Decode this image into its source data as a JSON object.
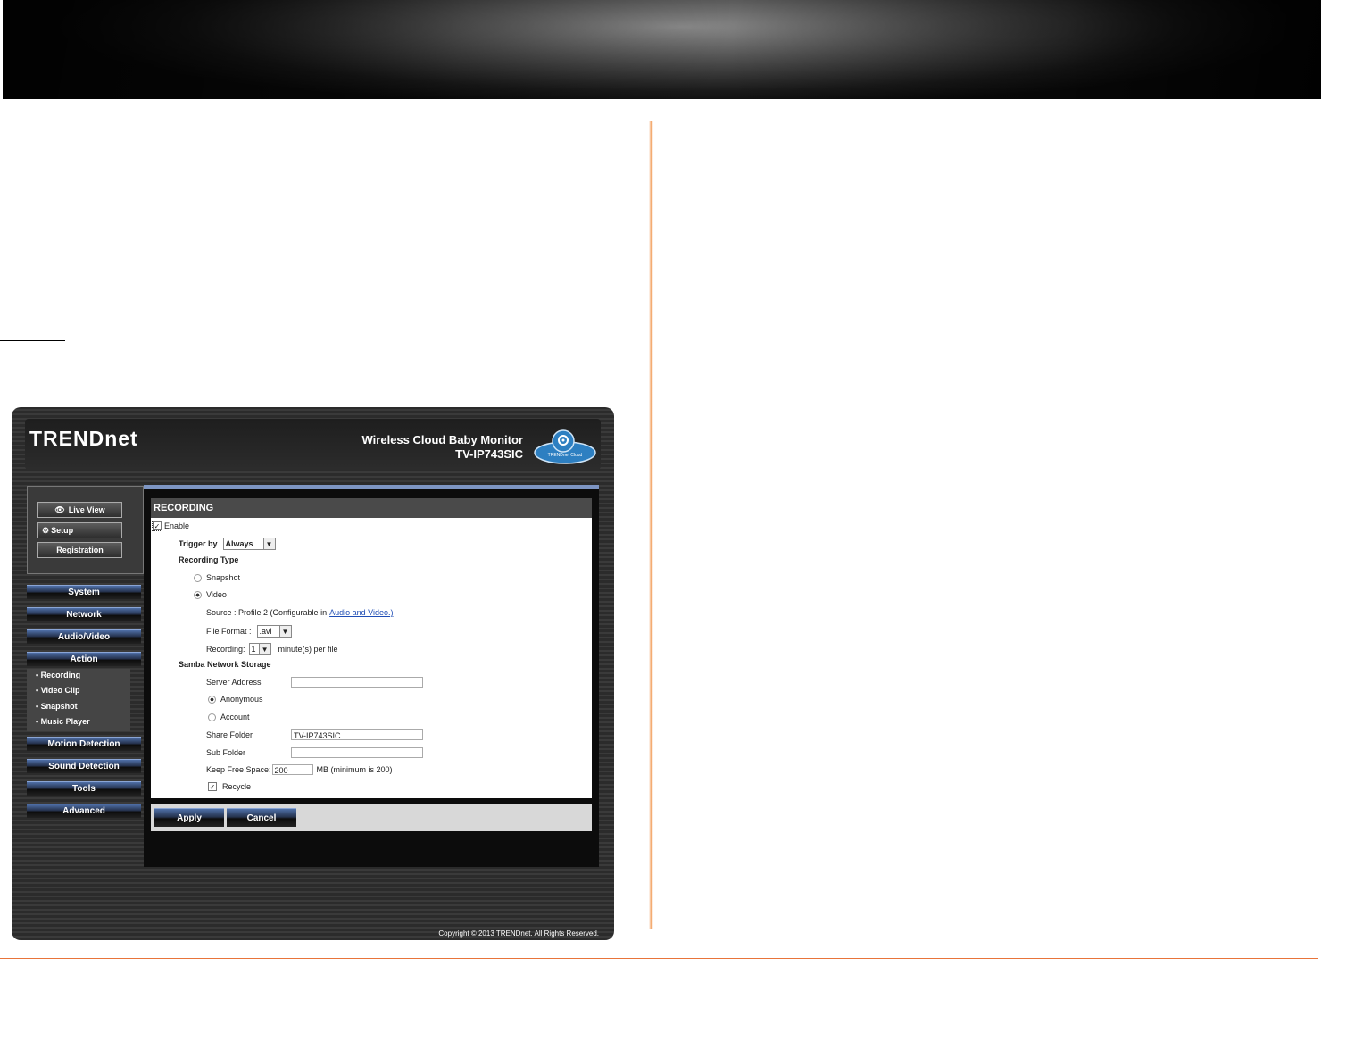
{
  "brand": {
    "logo": "TRENDnet",
    "product_name": "Wireless Cloud Baby Monitor",
    "model": "TV-IP743SIC",
    "cloud_badge": "TRENDnet Cloud"
  },
  "top_nav": {
    "live_view": "Live View",
    "setup": "Setup",
    "registration": "Registration"
  },
  "menu": [
    "System",
    "Network",
    "Audio/Video",
    "Action",
    "Motion Detection",
    "Sound Detection",
    "Tools",
    "Advanced"
  ],
  "action_submenu": [
    "Recording",
    "Video Clip",
    "Snapshot",
    "Music Player"
  ],
  "panel": {
    "title": "RECORDING",
    "enable_label": "Enable",
    "enable_checked": true,
    "trigger_label": "Trigger by",
    "trigger_value": "Always",
    "recording_type_label": "Recording Type",
    "snapshot_label": "Snapshot",
    "video_label": "Video",
    "source_text": "Source : Profile 2  (Configurable in",
    "source_link": "Audio and Video.)",
    "file_format_label": "File Format :",
    "file_format_value": ".avi",
    "recording_label": "Recording:",
    "recording_value": "1",
    "recording_suffix": "minute(s) per file",
    "samba_label": "Samba Network Storage",
    "server_address_label": "Server Address",
    "server_address_value": "",
    "anonymous_label": "Anonymous",
    "account_label": "Account",
    "share_folder_label": "Share Folder",
    "share_folder_value": "TV-IP743SIC",
    "sub_folder_label": "Sub Folder",
    "sub_folder_value": "",
    "keep_free_label": "Keep Free Space:",
    "keep_free_value": "200",
    "keep_free_suffix": "MB (minimum is 200)",
    "recycle_label": "Recycle",
    "recycle_checked": true
  },
  "buttons": {
    "apply": "Apply",
    "cancel": "Cancel"
  },
  "copyright": "Copyright © 2013 TRENDnet. All Rights Reserved.",
  "colors": {
    "accent_orange": "#e8743a",
    "menu_blue": "#4f70a8",
    "link_blue": "#1f4db5"
  }
}
